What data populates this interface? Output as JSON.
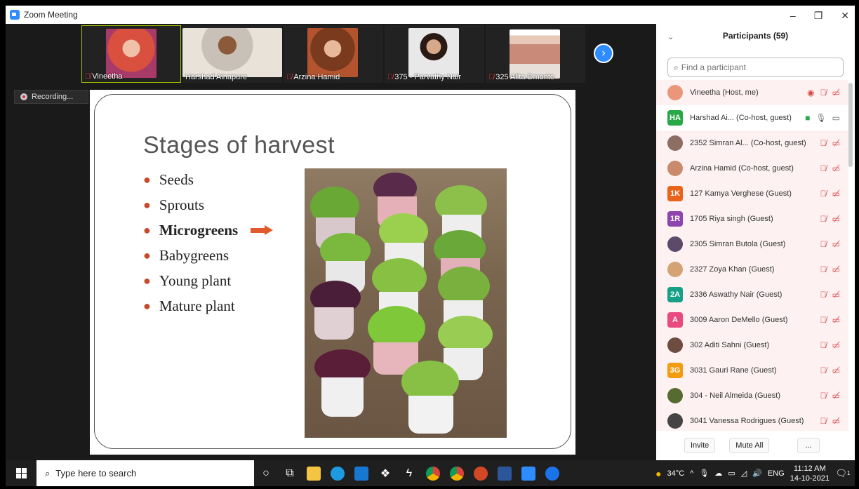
{
  "window": {
    "title": "Zoom Meeting",
    "accent": "#2d8cff"
  },
  "video_strip": {
    "tiles": [
      {
        "name": "Vineetha",
        "muted": true
      },
      {
        "name": "Harshad Ainapure",
        "muted": false
      },
      {
        "name": "Arzina Hamid",
        "muted": true
      },
      {
        "name": "375 - Parvathy Nair",
        "muted": true
      },
      {
        "name": "325 Alita Dmonte",
        "muted": true
      }
    ],
    "next_icon": "chevron-right-icon"
  },
  "recording": {
    "label": "Recording..."
  },
  "slide": {
    "title": "Stages of harvest",
    "bullets": [
      "Seeds",
      "Sprouts",
      "Microgreens",
      "Babygreens",
      "Young plant",
      "Mature plant"
    ],
    "highlighted": "Microgreens"
  },
  "panel": {
    "header": "Participants (59)",
    "search_placeholder": "Find a participant",
    "participants": [
      {
        "initials": "",
        "name": "Vineetha (Host, me)",
        "avatar_color": "#e9967a"
      },
      {
        "initials": "HA",
        "name": "Harshad Ai... (Co-host, guest)",
        "avatar_color": "#29a847"
      },
      {
        "initials": "",
        "name": "2352 Simran Al... (Co-host, guest)",
        "avatar_color": "#8d6e63"
      },
      {
        "initials": "",
        "name": "Arzina Hamid (Co-host, guest)",
        "avatar_color": "#c98b6b"
      },
      {
        "initials": "1K",
        "name": "127 Kamya Verghese (Guest)",
        "avatar_color": "#e8641b"
      },
      {
        "initials": "1R",
        "name": "1705 Riya singh (Guest)",
        "avatar_color": "#8e44ad"
      },
      {
        "initials": "",
        "name": "2305 Simran Butola (Guest)",
        "avatar_color": "#5d4a6b"
      },
      {
        "initials": "",
        "name": "2327 Zoya Khan (Guest)",
        "avatar_color": "#d4a373"
      },
      {
        "initials": "2A",
        "name": "2336 Aswathy Nair (Guest)",
        "avatar_color": "#16a085"
      },
      {
        "initials": "A",
        "name": "3009 Aaron DeMello (Guest)",
        "avatar_color": "#e84a7f"
      },
      {
        "initials": "",
        "name": "302 Aditi Sahni (Guest)",
        "avatar_color": "#6d4c41"
      },
      {
        "initials": "3G",
        "name": "3031 Gauri Rane (Guest)",
        "avatar_color": "#f39c12"
      },
      {
        "initials": "",
        "name": "304 - Neil Almeida (Guest)",
        "avatar_color": "#556b2f"
      },
      {
        "initials": "",
        "name": "3041 Vanessa Rodrigues (Guest)",
        "avatar_color": "#444444"
      }
    ],
    "footer": {
      "invite": "Invite",
      "mute_all": "Mute All",
      "more": "..."
    }
  },
  "taskbar": {
    "search_placeholder": "Type here to search",
    "weather": "34°C",
    "language": "ENG",
    "time": "11:12 AM",
    "date": "14-10-2021",
    "notification_count": "1"
  }
}
